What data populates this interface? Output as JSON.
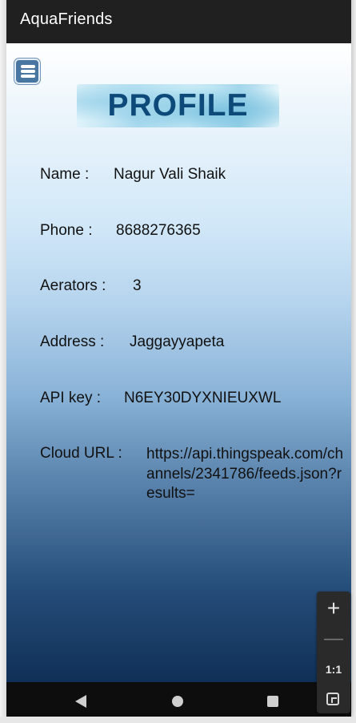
{
  "app": {
    "title": "AquaFriends"
  },
  "header": {
    "banner_title": "PROFILE"
  },
  "icons": {
    "menu": "hamburger-menu-icon",
    "nav_back": "back-triangle-icon",
    "nav_home": "home-circle-icon",
    "nav_recent": "recent-apps-square-icon",
    "zoom_in": "plus-icon",
    "zoom_out": "minus-icon",
    "zoom_fit": "fit-screen-icon"
  },
  "profile": {
    "fields": [
      {
        "label": "Name :",
        "value": "Nagur Vali Shaik"
      },
      {
        "label": "Phone :",
        "value": "8688276365"
      },
      {
        "label": "Aerators :",
        "value": "3"
      },
      {
        "label": "Address :",
        "value": "Jaggayyapeta"
      },
      {
        "label": "API key :",
        "value": "N6EY30DYXNIEUXWL"
      },
      {
        "label": "Cloud URL :",
        "value": "https://api.thingspeak.com/channels/2341786/feeds.json?results="
      }
    ]
  },
  "zoom_controls": {
    "plus": "+",
    "minus": "—",
    "one_to_one": "1:1"
  },
  "colors": {
    "app_bar": "#202020",
    "banner_text": "#0e4a79",
    "gradient_top": "#ffffff",
    "gradient_bottom": "#0f2f56",
    "menu_button": "#4a76a2"
  }
}
